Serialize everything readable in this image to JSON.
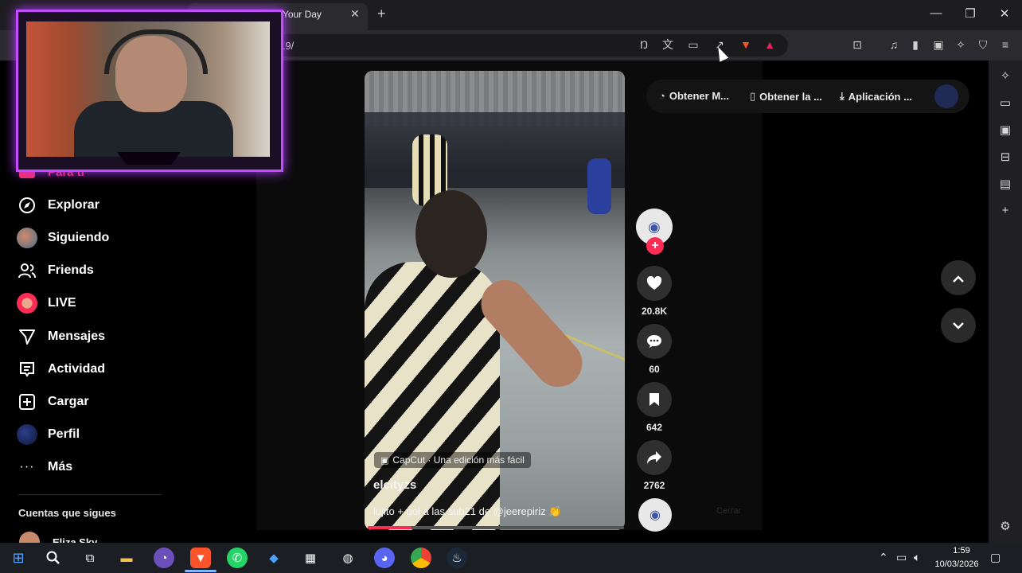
{
  "browser": {
    "tab_title": "Your Day",
    "tab_close": "✕",
    "new_tab": "+",
    "url": "/-419/",
    "window_controls": [
      "—",
      "❐",
      "✕"
    ],
    "toolbar_icons": [
      "no-translate-icon",
      "translate-icon",
      "cast-icon",
      "share-icon",
      "brave-shields-icon",
      "brave-rewards-icon"
    ],
    "right_toolbar_icons": [
      "tab-search-icon",
      "music-icon",
      "sidebar-icon",
      "wallet-icon",
      "leo-icon",
      "vpn-icon",
      "menu-icon"
    ]
  },
  "left_nav": {
    "para_ti": "Para ti",
    "items": [
      {
        "label": "Explorar",
        "icon": "compass-icon"
      },
      {
        "label": "Siguiendo",
        "icon": "avatar"
      },
      {
        "label": "Friends",
        "icon": "friends-icon"
      },
      {
        "label": "LIVE",
        "icon": "live-icon"
      },
      {
        "label": "Mensajes",
        "icon": "send-icon"
      },
      {
        "label": "Actividad",
        "icon": "inbox-icon"
      },
      {
        "label": "Cargar",
        "icon": "plus-box-icon"
      },
      {
        "label": "Perfil",
        "icon": "avatar"
      },
      {
        "label": "Más",
        "icon": "more-icon"
      }
    ],
    "following_title": "Cuentas que sigues",
    "following_accounts": [
      {
        "name": "Eliza Sky"
      }
    ]
  },
  "video": {
    "capcut_label": "CapCut · Una edición más fácil",
    "author": "elcityzs",
    "caption": "lujito + gol a las sub21 de @jeerepiriz 👏",
    "progress": 0.17
  },
  "actions": {
    "likes": "20.8K",
    "comments": "60",
    "saves": "642",
    "shares": "2762"
  },
  "top_pill": {
    "item1": "Obtener M...",
    "item2": "Obtener la ...",
    "item3": "Aplicación ..."
  },
  "faded": {
    "close_label": "Cerrar"
  },
  "taskbar": {
    "time": "1:59",
    "date": "10/03/2026"
  },
  "colors": {
    "accent": "#fe2c55",
    "webcam_frame": "#c24cff"
  }
}
